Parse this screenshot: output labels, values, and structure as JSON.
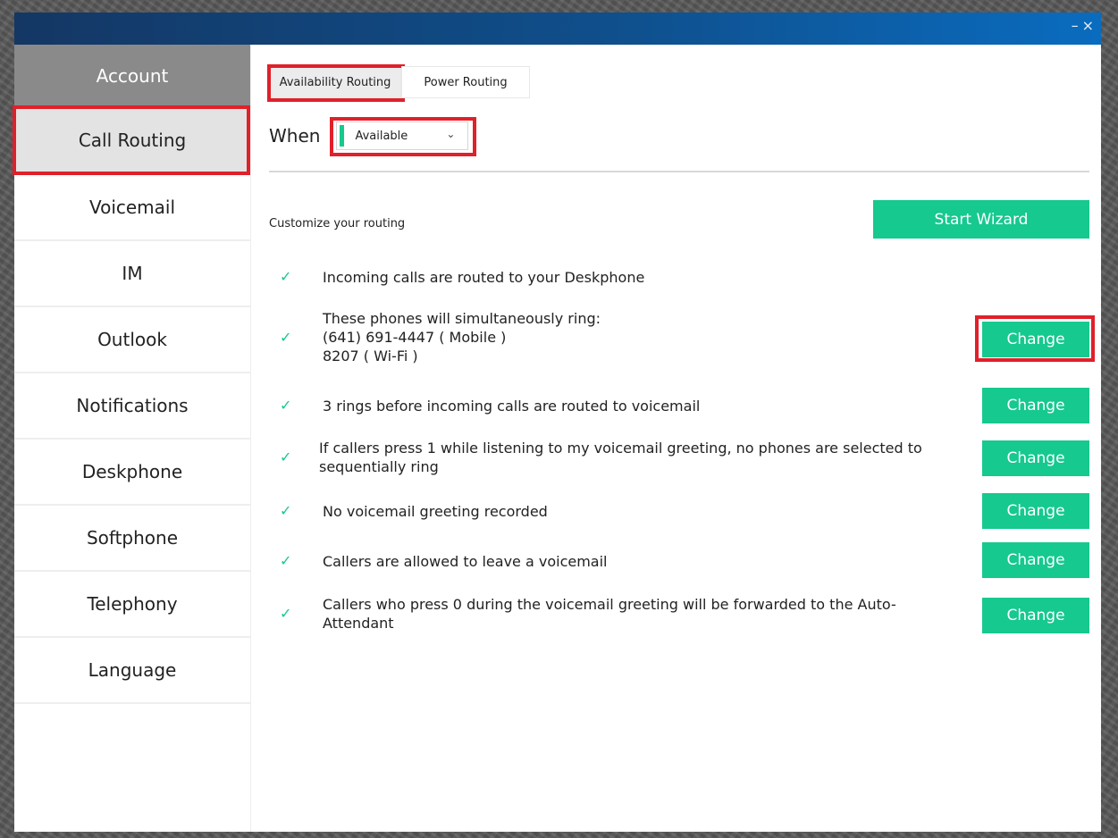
{
  "window": {
    "minimize_glyph": "–",
    "close_glyph": "×"
  },
  "sidebar": {
    "items": [
      {
        "label": "Account"
      },
      {
        "label": "Call Routing"
      },
      {
        "label": "Voicemail"
      },
      {
        "label": "IM"
      },
      {
        "label": "Outlook"
      },
      {
        "label": "Notifications"
      },
      {
        "label": "Deskphone"
      },
      {
        "label": "Softphone"
      },
      {
        "label": "Telephony"
      },
      {
        "label": "Language"
      }
    ]
  },
  "tabs": [
    {
      "label": "Availability Routing"
    },
    {
      "label": "Power Routing"
    }
  ],
  "when": {
    "label": "When",
    "status_value": "Available",
    "chevron": "⌄"
  },
  "customize": {
    "label": "Customize your routing",
    "wizard_label": "Start Wizard"
  },
  "check_glyph": "✓",
  "rules": [
    {
      "lines": [
        "Incoming calls are routed to your Deskphone"
      ]
    },
    {
      "lines": [
        "These phones will simultaneously ring:",
        "(641) 691-4447 ( Mobile )",
        "8207 ( Wi-Fi )"
      ],
      "button": "Change"
    },
    {
      "lines": [
        "3 rings before incoming calls are routed to voicemail"
      ],
      "button": "Change"
    },
    {
      "lines": [
        "If callers press 1 while listening to my voicemail greeting, no phones are selected to",
        "sequentially ring"
      ],
      "button": "Change"
    },
    {
      "lines": [
        "No voicemail greeting recorded"
      ],
      "button": "Change"
    },
    {
      "lines": [
        "Callers are allowed to leave a voicemail"
      ],
      "button": "Change"
    },
    {
      "lines": [
        "Callers who press 0 during the voicemail greeting will be forwarded to the Auto-",
        "Attendant"
      ],
      "button": "Change"
    }
  ],
  "colors": {
    "accent": "#16c98e",
    "highlight": "#e0202a",
    "titlebar": "#0f4f8c",
    "sidebar_header": "#8a8a8a"
  }
}
